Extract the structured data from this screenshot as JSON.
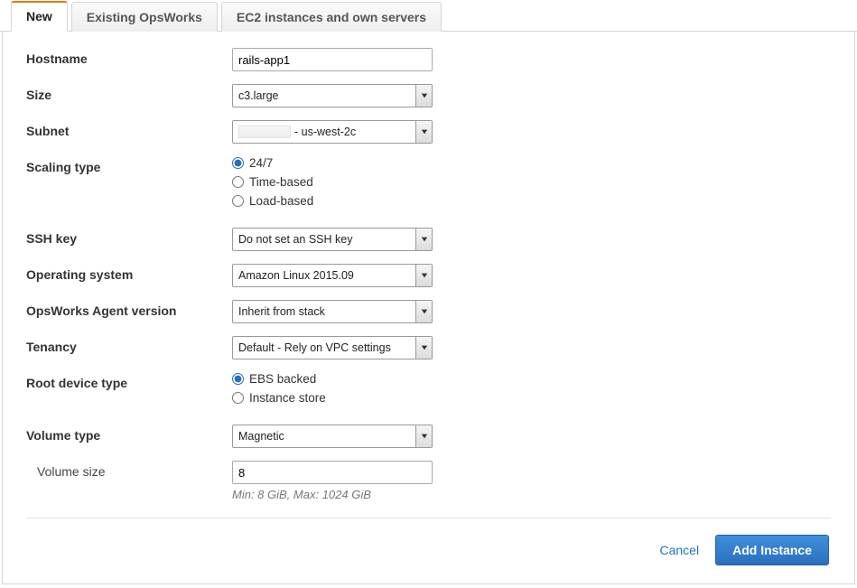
{
  "tabs": {
    "new": "New",
    "existing": "Existing OpsWorks",
    "ec2": "EC2 instances and own servers"
  },
  "labels": {
    "hostname": "Hostname",
    "size": "Size",
    "subnet": "Subnet",
    "scaling_type": "Scaling type",
    "ssh_key": "SSH key",
    "os": "Operating system",
    "agent_version": "OpsWorks Agent version",
    "tenancy": "Tenancy",
    "root_device": "Root device type",
    "volume_type": "Volume type",
    "volume_size": "Volume size"
  },
  "fields": {
    "hostname_value": "rails-app1",
    "size_value": "c3.large",
    "subnet_suffix": "- us-west-2c",
    "ssh_key_value": "Do not set an SSH key",
    "os_value": "Amazon Linux 2015.09",
    "agent_version_value": "Inherit from stack",
    "tenancy_value": "Default - Rely on VPC settings",
    "volume_type_value": "Magnetic",
    "volume_size_value": "8",
    "volume_size_hint": "Min: 8 GiB, Max: 1024 GiB"
  },
  "scaling_type": {
    "opt_247": "24/7",
    "opt_time": "Time-based",
    "opt_load": "Load-based",
    "selected": "24/7"
  },
  "root_device": {
    "opt_ebs": "EBS backed",
    "opt_instance": "Instance store",
    "selected": "EBS backed"
  },
  "actions": {
    "cancel": "Cancel",
    "add_instance": "Add Instance"
  }
}
